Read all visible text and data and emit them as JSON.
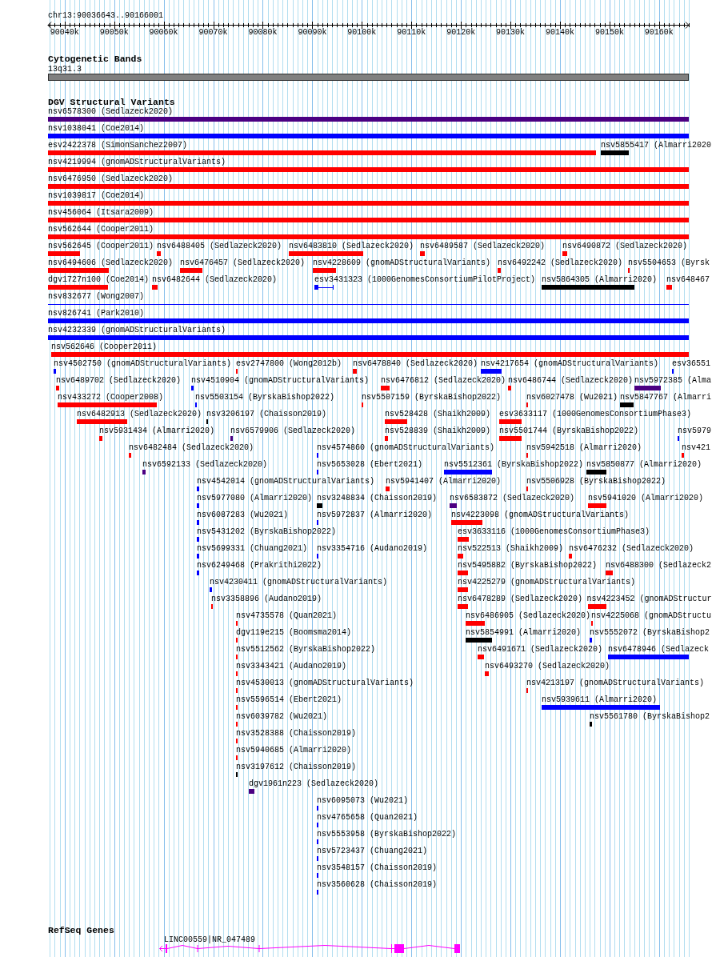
{
  "location": "chr13:90036643..90166001",
  "ruler": {
    "ticks": [
      "90040k",
      "90050k",
      "90060k",
      "90070k",
      "90080k",
      "90090k",
      "90100k",
      "90110k",
      "90120k",
      "90130k",
      "90140k",
      "90150k",
      "90160k"
    ]
  },
  "tracks": [
    {
      "kind": "cytoband",
      "title": "Cytogenetic Bands",
      "band": "13q31.3"
    },
    {
      "kind": "variants",
      "title": "DGV Structural Variants",
      "rows": [
        [
          {
            "label": "nsv6578300 (Sedlazeck2020)",
            "color": "#4b0082",
            "kind": "bar"
          }
        ],
        [
          {
            "label": "nsv1038041 (Coe2014)",
            "color": "#0000ff",
            "kind": "bar"
          }
        ],
        [
          {
            "label": "esv2422378 (SimonSanchez2007)",
            "color": "#ff0000",
            "kind": "bar"
          },
          {
            "label": "nsv5855417 (Almarri2020",
            "color": "#000000",
            "kind": "bar"
          }
        ],
        [
          {
            "label": "nsv4219994 (gnomADStructuralVariants)",
            "color": "#ff0000",
            "kind": "bar"
          }
        ],
        [
          {
            "label": "nsv6476950 (Sedlazeck2020)",
            "color": "#ff0000",
            "kind": "bar"
          }
        ],
        [
          {
            "label": "nsv1039817 (Coe2014)",
            "color": "#ff0000",
            "kind": "bar"
          }
        ],
        [
          {
            "label": "nsv456064 (Itsara2009)",
            "color": "#ff0000",
            "kind": "bar"
          }
        ],
        [
          {
            "label": "nsv562644 (Cooper2011)",
            "color": "#ff0000",
            "kind": "bar"
          }
        ],
        [
          {
            "label": "nsv562645 (Cooper2011)",
            "color": "#ff0000",
            "kind": "bar"
          },
          {
            "label": "nsv6488405 (Sedlazeck2020)",
            "color": "#ff0000",
            "kind": "bar"
          },
          {
            "label": "nsv6483810 (Sedlazeck2020)",
            "color": "#ff0000",
            "kind": "bar"
          },
          {
            "label": "nsv6489587 (Sedlazeck2020)",
            "color": "#ff0000",
            "kind": "bar"
          },
          {
            "label": "nsv6490872 (Sedlazeck2020)",
            "color": "#ff0000",
            "kind": "bar"
          }
        ],
        [
          {
            "label": "nsv6494606 (Sedlazeck2020)",
            "color": "#ff0000",
            "kind": "bar"
          },
          {
            "label": "nsv6476457 (Sedlazeck2020)",
            "color": "#ff0000",
            "kind": "bar"
          },
          {
            "label": "nsv4228609 (gnomADStructuralVariants)",
            "color": "#ff0000",
            "kind": "bar"
          },
          {
            "label": "nsv6492242 (Sedlazeck2020)",
            "color": "#ff0000",
            "kind": "bar"
          },
          {
            "label": "nsv5504653 (Byrsk",
            "color": "#ff0000",
            "kind": "bar"
          }
        ],
        [
          {
            "label": "dgv1727n100 (Coe2014)",
            "color": "#ff0000",
            "kind": "bar"
          },
          {
            "label": "nsv6482644 (Sedlazeck2020)",
            "color": "#ff0000",
            "kind": "bar"
          },
          {
            "label": "esv3431323 (1000GenomesConsortiumPilotProject)",
            "color": "#0000ff",
            "kind": "split"
          },
          {
            "label": "nsv5864305 (Almarri2020)",
            "color": "#000000",
            "kind": "bar"
          },
          {
            "label": "nsv648467",
            "color": "#ff0000",
            "kind": "bar"
          }
        ],
        [
          {
            "label": "nsv832677 (Wong2007)",
            "color": "#0000ff",
            "kind": "line"
          }
        ],
        [
          {
            "label": "nsv826741 (Park2010)",
            "color": "#0000ff",
            "kind": "bar"
          }
        ],
        [
          {
            "label": "nsv4232339 (gnomADStructuralVariants)",
            "color": "#0000ff",
            "kind": "bar"
          }
        ],
        [
          {
            "label": "nsv562646 (Cooper2011)",
            "color": "#ff0000",
            "kind": "bar"
          }
        ],
        [
          {
            "label": "nsv4502750 (gnomADStructuralVariants)",
            "color": "#0000ff",
            "kind": "bar"
          },
          {
            "label": "esv2747800 (Wong2012b)",
            "color": "#ff0000",
            "kind": "bar"
          },
          {
            "label": "nsv6478840 (Sedlazeck2020)",
            "color": "#ff0000",
            "kind": "bar"
          },
          {
            "label": "nsv4217654 (gnomADStructuralVariants)",
            "color": "#0000ff",
            "kind": "bar"
          },
          {
            "label": "esv36551",
            "color": "#0000ff",
            "kind": "bar"
          }
        ],
        [
          {
            "label": "nsv6489702 (Sedlazeck2020)",
            "color": "#ff0000",
            "kind": "bar"
          },
          {
            "label": "nsv4510904 (gnomADStructuralVariants)",
            "color": "#0000ff",
            "kind": "bar"
          },
          {
            "label": "nsv6476812 (Sedlazeck2020)",
            "color": "#ff0000",
            "kind": "bar"
          },
          {
            "label": "nsv6486744 (Sedlazeck2020)",
            "color": "#ff0000",
            "kind": "bar"
          },
          {
            "label": "nsv5972385 (Alma",
            "color": "#4b0082",
            "kind": "bar"
          }
        ],
        [
          {
            "label": "nsv433272 (Cooper2008)",
            "color": "#ff0000",
            "kind": "bar"
          },
          {
            "label": "nsv5503154 (ByrskaBishop2022)",
            "color": "#0000ff",
            "kind": "bar"
          },
          {
            "label": "nsv5507159 (ByrskaBishop2022)",
            "color": "#ff0000",
            "kind": "bar"
          },
          {
            "label": "nsv6027478 (Wu2021)",
            "color": "#ff0000",
            "kind": "bar"
          },
          {
            "label": "nsv5847767 (Almarri",
            "color": "#000000",
            "kind": "bar"
          }
        ],
        [
          {
            "label": "nsv6482913 (Sedlazeck2020)",
            "color": "#ff0000",
            "kind": "bar"
          },
          {
            "label": "nsv3206197 (Chaisson2019)",
            "color": "#000000",
            "kind": "bar"
          },
          {
            "label": "nsv528428 (Shaikh2009)",
            "color": "#ff0000",
            "kind": "bar"
          },
          {
            "label": "esv3633117 (1000GenomesConsortiumPhase3)",
            "color": "#ff0000",
            "kind": "bar"
          }
        ],
        [
          {
            "label": "nsv5931434 (Almarri2020)",
            "color": "#ff0000",
            "kind": "bar"
          },
          {
            "label": "nsv6579906 (Sedlazeck2020)",
            "color": "#4b0082",
            "kind": "bar"
          },
          {
            "label": "nsv528839 (Shaikh2009)",
            "color": "#ff0000",
            "kind": "bar"
          },
          {
            "label": "nsv5501744 (ByrskaBishop2022)",
            "color": "#ff0000",
            "kind": "bar"
          },
          {
            "label": "nsv5979",
            "color": "#0000ff",
            "kind": "bar"
          }
        ],
        [
          {
            "label": "nsv6482484 (Sedlazeck2020)",
            "color": "#ff0000",
            "kind": "bar"
          },
          {
            "label": "nsv4574860 (gnomADStructuralVariants)",
            "color": "#0000ff",
            "kind": "bar"
          },
          {
            "label": "nsv5942518 (Almarri2020)",
            "color": "#ff0000",
            "kind": "bar"
          },
          {
            "label": "nsv421",
            "color": "#ff0000",
            "kind": "bar"
          }
        ],
        [
          {
            "label": "nsv6592133 (Sedlazeck2020)",
            "color": "#4b0082",
            "kind": "bar"
          },
          {
            "label": "nsv5653028 (Ebert2021)",
            "color": "#0000ff",
            "kind": "bar"
          },
          {
            "label": "nsv5512361 (ByrskaBishop2022)",
            "color": "#0000ff",
            "kind": "bar"
          },
          {
            "label": "nsv5850877 (Almarri2020)",
            "color": "#000000",
            "kind": "bar"
          }
        ],
        [
          {
            "label": "nsv4542014 (gnomADStructuralVariants)",
            "color": "#0000ff",
            "kind": "bar"
          },
          {
            "label": "nsv5941407 (Almarri2020)",
            "color": "#ff0000",
            "kind": "bar"
          },
          {
            "label": "nsv5506928 (ByrskaBishop2022)",
            "color": "#ff0000",
            "kind": "bar"
          }
        ],
        [
          {
            "label": "nsv5977080 (Almarri2020)",
            "color": "#0000ff",
            "kind": "bar"
          },
          {
            "label": "nsv3248834 (Chaisson2019)",
            "color": "#000000",
            "kind": "bar"
          },
          {
            "label": "nsv6583872 (Sedlazeck2020)",
            "color": "#4b0082",
            "kind": "bar"
          },
          {
            "label": "nsv5941020 (Almarri2020)",
            "color": "#ff0000",
            "kind": "bar"
          }
        ],
        [
          {
            "label": "nsv6087283 (Wu2021)",
            "color": "#0000ff",
            "kind": "bar"
          },
          {
            "label": "nsv5972837 (Almarri2020)",
            "color": "#0000ff",
            "kind": "bar"
          },
          {
            "label": "nsv4223098 (gnomADStructuralVariants)",
            "color": "#ff0000",
            "kind": "bar"
          }
        ],
        [
          {
            "label": "nsv5431202 (ByrskaBishop2022)",
            "color": "#0000ff",
            "kind": "bar"
          },
          {
            "label": "esv3633116 (1000GenomesConsortiumPhase3)",
            "color": "#ff0000",
            "kind": "bar"
          }
        ],
        [
          {
            "label": "nsv5699331 (Chuang2021)",
            "color": "#0000ff",
            "kind": "bar"
          },
          {
            "label": "nsv3354716 (Audano2019)",
            "color": "#0000ff",
            "kind": "bar"
          },
          {
            "label": "nsv522513 (Shaikh2009)",
            "color": "#ff0000",
            "kind": "bar"
          },
          {
            "label": "nsv6476232 (Sedlazeck2020)",
            "color": "#ff0000",
            "kind": "bar"
          }
        ],
        [
          {
            "label": "nsv6249468 (Prakrithi2022)",
            "color": "#0000ff",
            "kind": "bar"
          },
          {
            "label": "nsv5495882 (ByrskaBishop2022)",
            "color": "#ff0000",
            "kind": "bar"
          },
          {
            "label": "nsv6488300 (Sedlazeck2",
            "color": "#ff0000",
            "kind": "bar"
          }
        ],
        [
          {
            "label": "nsv4230411 (gnomADStructuralVariants)",
            "color": "#0000ff",
            "kind": "bar"
          },
          {
            "label": "nsv4225279 (gnomADStructuralVariants)",
            "color": "#ff0000",
            "kind": "bar"
          }
        ],
        [
          {
            "label": "nsv3358896 (Audano2019)",
            "color": "#ff0000",
            "kind": "bar"
          },
          {
            "label": "nsv6478289 (Sedlazeck2020)",
            "color": "#ff0000",
            "kind": "bar"
          },
          {
            "label": "nsv4223452 (gnomADStructur",
            "color": "#ff0000",
            "kind": "bar"
          }
        ],
        [
          {
            "label": "nsv4735578 (Quan2021)",
            "color": "#ff0000",
            "kind": "bar"
          },
          {
            "label": "nsv6486905 (Sedlazeck2020)",
            "color": "#ff0000",
            "kind": "bar"
          },
          {
            "label": "nsv4225068 (gnomADStructu",
            "color": "#ff0000",
            "kind": "bar"
          }
        ],
        [
          {
            "label": "dgv119e215 (Boomsma2014)",
            "color": "#ff0000",
            "kind": "bar"
          },
          {
            "label": "nsv5854991 (Almarri2020)",
            "color": "#000000",
            "kind": "bar"
          },
          {
            "label": "nsv5552072 (ByrskaBishop2",
            "color": "#0000ff",
            "kind": "bar"
          }
        ],
        [
          {
            "label": "nsv5512562 (ByrskaBishop2022)",
            "color": "#ff0000",
            "kind": "bar"
          },
          {
            "label": "nsv6491671 (Sedlazeck2020)",
            "color": "#ff0000",
            "kind": "bar"
          },
          {
            "label": "nsv6478946 (Sedlazeck",
            "color": "#0000ff",
            "kind": "bar"
          }
        ],
        [
          {
            "label": "nsv3343421 (Audano2019)",
            "color": "#ff0000",
            "kind": "bar"
          },
          {
            "label": "nsv6493270 (Sedlazeck2020)",
            "color": "#ff0000",
            "kind": "bar"
          }
        ],
        [
          {
            "label": "nsv4530013 (gnomADStructuralVariants)",
            "color": "#ff0000",
            "kind": "bar"
          },
          {
            "label": "nsv4213197 (gnomADStructuralVariants)",
            "color": "#ff0000",
            "kind": "bar"
          }
        ],
        [
          {
            "label": "nsv5596514 (Ebert2021)",
            "color": "#ff0000",
            "kind": "bar"
          },
          {
            "label": "nsv5939611 (Almarri2020)",
            "color": "#0000ff",
            "kind": "bar"
          }
        ],
        [
          {
            "label": "nsv6039782 (Wu2021)",
            "color": "#ff0000",
            "kind": "bar"
          },
          {
            "label": "nsv5561780 (ByrskaBishop2",
            "color": "#000000",
            "kind": "bar"
          }
        ],
        [
          {
            "label": "nsv3528388 (Chaisson2019)",
            "color": "#ff0000",
            "kind": "bar"
          }
        ],
        [
          {
            "label": "nsv5940685 (Almarri2020)",
            "color": "#ff0000",
            "kind": "bar"
          }
        ],
        [
          {
            "label": "nsv3197612 (Chaisson2019)",
            "color": "#000000",
            "kind": "bar"
          }
        ],
        [
          {
            "label": "dgv1961n223 (Sedlazeck2020)",
            "color": "#4b0082",
            "kind": "bar"
          }
        ],
        [
          {
            "label": "nsv6095073 (Wu2021)",
            "color": "#0000ff",
            "kind": "bar"
          }
        ],
        [
          {
            "label": "nsv4765658 (Quan2021)",
            "color": "#0000ff",
            "kind": "bar"
          }
        ],
        [
          {
            "label": "nsv5553958 (ByrskaBishop2022)",
            "color": "#0000ff",
            "kind": "bar"
          }
        ],
        [
          {
            "label": "nsv5723437 (Chuang2021)",
            "color": "#0000ff",
            "kind": "bar"
          }
        ],
        [
          {
            "label": "nsv3548157 (Chaisson2019)",
            "color": "#0000ff",
            "kind": "bar"
          }
        ],
        [
          {
            "label": "nsv3560628 (Chaisson2019)",
            "color": "#0000ff",
            "kind": "bar"
          }
        ]
      ]
    },
    {
      "kind": "genes",
      "title": "RefSeq Genes",
      "genes": [
        {
          "label": "LINC00559|NR_047489"
        }
      ]
    }
  ]
}
